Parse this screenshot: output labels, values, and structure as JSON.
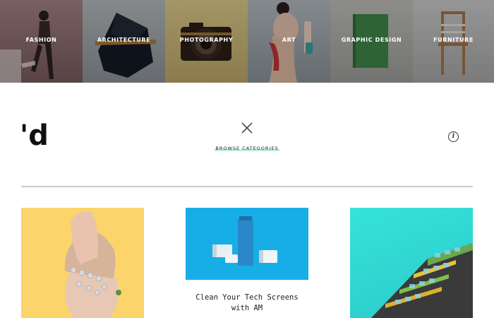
{
  "categories": [
    {
      "label": "FASHION",
      "color": "#8c6b6b"
    },
    {
      "label": "ARCHITECTURE",
      "color": "#9aa0a4"
    },
    {
      "label": "PHOTOGRAPHY",
      "color": "#c7b073"
    },
    {
      "label": "ART",
      "color": "#9aa3a8"
    },
    {
      "label": "GRAPHIC DESIGN",
      "color": "#a8a8a4"
    },
    {
      "label": "FURNITURE",
      "color": "#b5b5b5"
    }
  ],
  "header": {
    "logo_text": "'d",
    "browse_label": "BROWSE CATEGORIES",
    "info_glyph": "i",
    "close_icon": "close-icon",
    "info_icon": "info-icon"
  },
  "cards": [
    {
      "title": "",
      "bg": "#fbd46b"
    },
    {
      "title": "Clean Your Tech Screens with AM",
      "bg": "#17aee8"
    },
    {
      "title": "",
      "bg": "#37e3d8"
    }
  ],
  "colors": {
    "accent_highlight": "#b9efd8",
    "divider": "#c9c9c9"
  }
}
